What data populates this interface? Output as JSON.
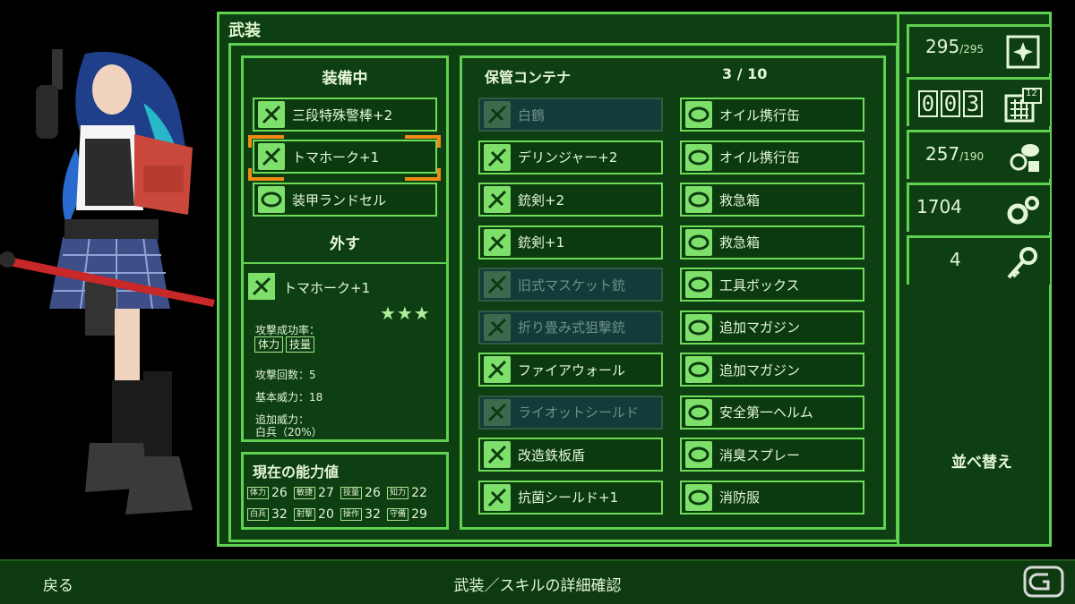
{
  "panel_title": "武装",
  "equipped": {
    "heading": "装備中",
    "items": [
      "三段特殊警棒+2",
      "トマホーク+1",
      "装甲ランドセル"
    ],
    "unequip_label": "外す"
  },
  "detail": {
    "name": "トマホーク+1",
    "stars": "★★★",
    "hit_rate_label": "攻撃成功率：",
    "hit_rate_tags": [
      "体力",
      "技量"
    ],
    "attack_count": "攻撃回数：5",
    "base_power": "基本威力：18",
    "extra_power_label": "追加威力：",
    "extra_power_value": "白兵（20%）"
  },
  "abilities": {
    "heading": "現在の能力値",
    "rows": [
      [
        {
          "label": "体力",
          "value": "26"
        },
        {
          "label": "敏捷",
          "value": "27"
        },
        {
          "label": "技量",
          "value": "26"
        },
        {
          "label": "知力",
          "value": "22"
        }
      ],
      [
        {
          "label": "白兵",
          "value": "32"
        },
        {
          "label": "射撃",
          "value": "20"
        },
        {
          "label": "操作",
          "value": "32"
        },
        {
          "label": "守備",
          "value": "29"
        }
      ]
    ]
  },
  "container": {
    "heading": "保管コンテナ",
    "count": "3 / 10",
    "left_items": [
      {
        "label": "白鶴",
        "disabled": true
      },
      {
        "label": "デリンジャー+2",
        "disabled": false
      },
      {
        "label": "銃剣+2",
        "disabled": false
      },
      {
        "label": "銃剣+1",
        "disabled": false
      },
      {
        "label": "旧式マスケット銃",
        "disabled": true
      },
      {
        "label": "折り畳み式狙撃銃",
        "disabled": true
      },
      {
        "label": "ファイアウォール",
        "disabled": false
      },
      {
        "label": "ライオットシールド",
        "disabled": true
      },
      {
        "label": "改造鉄板盾",
        "disabled": false
      },
      {
        "label": "抗菌シールド+1",
        "disabled": false
      }
    ],
    "right_items": [
      {
        "label": "オイル携行缶"
      },
      {
        "label": "オイル携行缶"
      },
      {
        "label": "救急箱"
      },
      {
        "label": "救急箱"
      },
      {
        "label": "工具ボックス"
      },
      {
        "label": "追加マガジン"
      },
      {
        "label": "追加マガジン"
      },
      {
        "label": "安全第一ヘルム"
      },
      {
        "label": "消臭スプレー"
      },
      {
        "label": "消防服"
      }
    ]
  },
  "stats": {
    "hp": {
      "value": "295",
      "max": "/295"
    },
    "days": {
      "digits": [
        "0",
        "0",
        "3"
      ],
      "calendar": "12"
    },
    "food": {
      "value": "257",
      "max": "/190"
    },
    "parts": {
      "value": "1704"
    },
    "keys": {
      "value": "4"
    }
  },
  "sort_label": "並べ替え",
  "footer": {
    "back": "戻る",
    "title": "武装／スキルの詳細確認"
  },
  "colors": {
    "panel_bg": "#0e3f12",
    "border": "#5fd04f",
    "selection": "#f28a14",
    "text": "#e3f7d6"
  }
}
